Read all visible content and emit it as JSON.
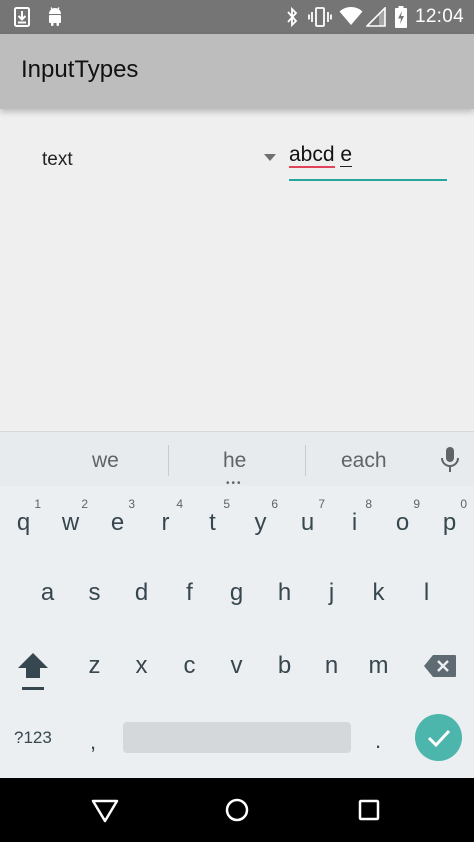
{
  "status_bar": {
    "time": "12:04",
    "left_icons": [
      "download-icon",
      "android-icon"
    ],
    "right_icons": [
      "bluetooth-icon",
      "vibrate-icon",
      "wifi-icon",
      "signal-icon",
      "battery-charging-icon"
    ]
  },
  "app_bar": {
    "title": "InputTypes"
  },
  "form": {
    "type_label": "text",
    "edit_words": [
      "abcd",
      "e"
    ]
  },
  "keyboard": {
    "suggestions": [
      "we",
      "he",
      "each"
    ],
    "row1": [
      {
        "key": "q",
        "hint": "1"
      },
      {
        "key": "w",
        "hint": "2"
      },
      {
        "key": "e",
        "hint": "3"
      },
      {
        "key": "r",
        "hint": "4"
      },
      {
        "key": "t",
        "hint": "5"
      },
      {
        "key": "y",
        "hint": "6"
      },
      {
        "key": "u",
        "hint": "7"
      },
      {
        "key": "i",
        "hint": "8"
      },
      {
        "key": "o",
        "hint": "9"
      },
      {
        "key": "p",
        "hint": "0"
      }
    ],
    "row2": [
      "a",
      "s",
      "d",
      "f",
      "g",
      "h",
      "j",
      "k",
      "l"
    ],
    "row3": [
      "z",
      "x",
      "c",
      "v",
      "b",
      "n",
      "m"
    ],
    "symbols_label": "?123",
    "comma_label": ",",
    "period_label": "."
  },
  "colors": {
    "accent": "#26a69a",
    "enter_key": "#4db6ac",
    "spell_error": "#e0435a",
    "app_bar": "#bdbdbd",
    "status_bar": "#757575"
  },
  "nav_bar": {
    "icons": [
      "back-icon",
      "home-icon",
      "recents-icon"
    ]
  }
}
